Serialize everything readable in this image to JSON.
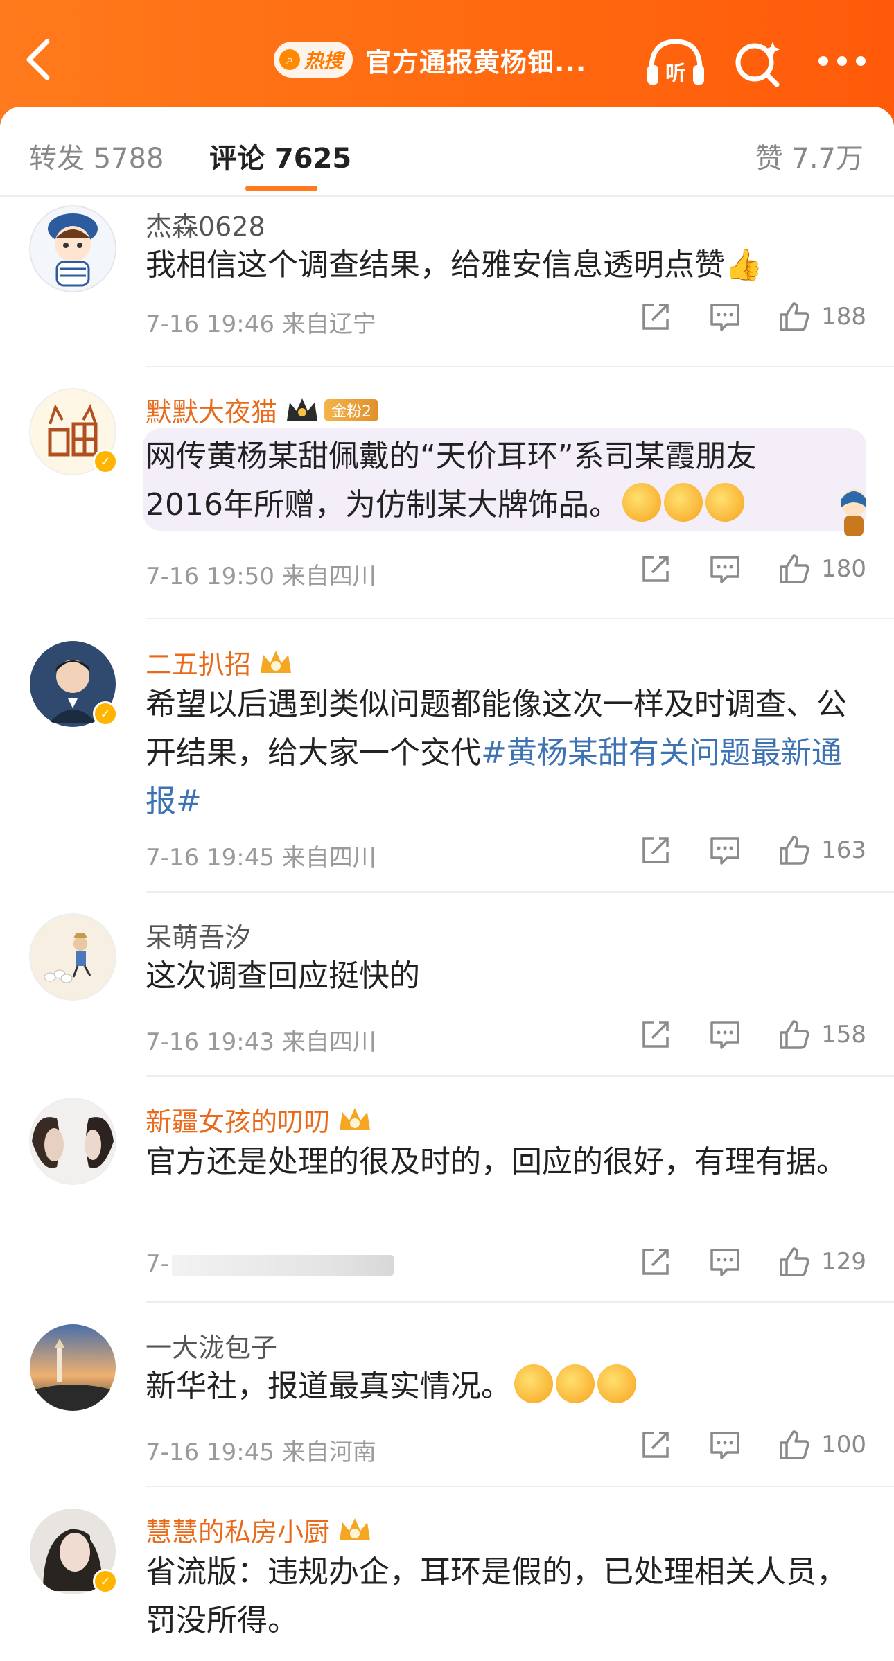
{
  "header": {
    "hot_badge": "热搜",
    "title": "官方通报黄杨钿...",
    "listen_label": "听"
  },
  "tabs": {
    "repost": "转发 5788",
    "comment": "评论 7625",
    "likes": "赞 7.7万"
  },
  "colors": {
    "header_orange": "#ff6a10",
    "vip_name": "#e86a1a",
    "topic_link": "#3d72b4"
  },
  "comments": [
    {
      "name": "杰森0628",
      "vip": false,
      "text": "我相信这个调查结果，给雅安信息透明点赞👍",
      "time": "7-16 19:46",
      "location": "来自辽宁",
      "likes": "188"
    },
    {
      "name": "默默大夜猫",
      "vip": true,
      "fan_badge": "金粉2",
      "text_line1": "网传黄杨某甜佩戴的“天价耳环”系司某霞朋友",
      "text_line2": "2016年所赠，为仿制某大牌饰品。",
      "time": "7-16 19:50",
      "location": "来自四川",
      "likes": "180"
    },
    {
      "name": "二五扒招",
      "vip": true,
      "text": "希望以后遇到类似问题都能像这次一样及时调查、公开结果，给大家一个交代",
      "topic": "#黄杨某甜有关问题最新通报#",
      "time": "7-16 19:45",
      "location": "来自四川",
      "likes": "163"
    },
    {
      "name": "呆萌吾汐",
      "vip": false,
      "text": "这次调查回应挺快的",
      "time": "7-16 19:43",
      "location": "来自四川",
      "likes": "158"
    },
    {
      "name": "新疆女孩的叨叨",
      "vip": true,
      "text": "官方还是处理的很及时的，回应的很好，有理有据。",
      "time_partial": "7-",
      "likes": "129"
    },
    {
      "name": "一大泷包子",
      "vip": false,
      "text": "新华社，报道最真实情况。",
      "time": "7-16 19:45",
      "location": "来自河南",
      "likes": "100"
    },
    {
      "name": "慧慧的私房小厨",
      "vip": true,
      "text": "省流版：违规办企，耳环是假的，已处理相关人员，罚没所得。"
    }
  ]
}
